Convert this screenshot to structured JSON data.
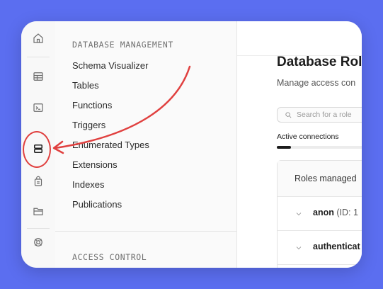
{
  "colors": {
    "background": "#5b6ef0",
    "annotation": "#e0403f",
    "accent": "#1c1c1c"
  },
  "rail": {
    "icons": [
      {
        "name": "home-icon"
      },
      {
        "name": "table-editor-icon"
      },
      {
        "name": "sql-editor-icon"
      },
      {
        "name": "database-icon",
        "active": true
      },
      {
        "name": "auth-icon"
      },
      {
        "name": "storage-icon"
      },
      {
        "name": "realtime-icon"
      }
    ]
  },
  "menu": {
    "database_management_title": "DATABASE MANAGEMENT",
    "items": [
      {
        "label": "Schema Visualizer"
      },
      {
        "label": "Tables"
      },
      {
        "label": "Functions"
      },
      {
        "label": "Triggers"
      },
      {
        "label": "Enumerated Types"
      },
      {
        "label": "Extensions"
      },
      {
        "label": "Indexes"
      },
      {
        "label": "Publications"
      }
    ],
    "access_control_title": "ACCESS CONTROL"
  },
  "main": {
    "title": "Database Rol",
    "subtitle": "Manage access con",
    "search_placeholder": "Search for a role",
    "active_connections_label": "Active connections",
    "active_connections_fraction": 0.1,
    "roles_header": "Roles managed",
    "roles": [
      {
        "name": "anon",
        "id_text": "(ID: 1"
      },
      {
        "name": "authenticat",
        "id_text": ""
      }
    ]
  }
}
